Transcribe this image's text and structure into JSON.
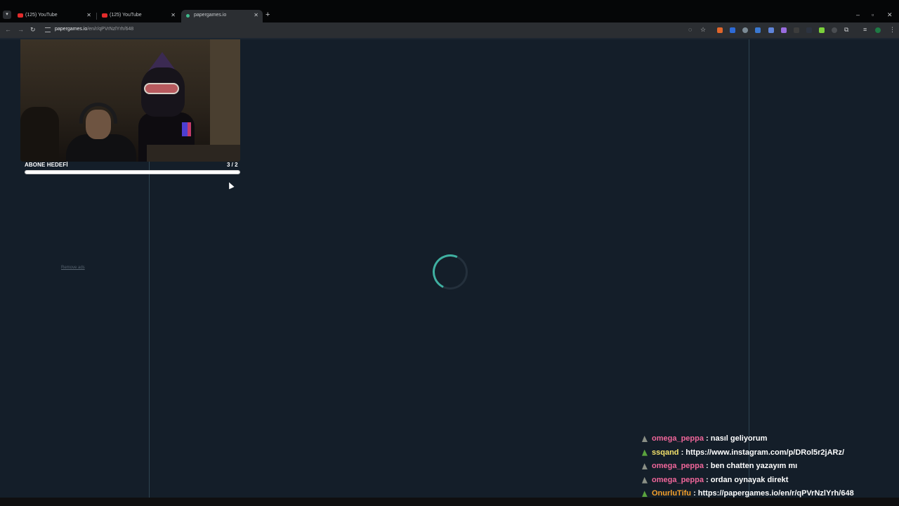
{
  "browser": {
    "tabs": [
      {
        "title": "(125) YouTube",
        "favicon": "youtube-icon",
        "active": false
      },
      {
        "title": "(125) YouTube",
        "favicon": "youtube-icon",
        "active": false
      },
      {
        "title": "papergames.io",
        "favicon": "papergames-icon",
        "active": true
      }
    ],
    "url_host": "papergames.io",
    "url_path": "/en/r/qPVrNzlYrh/648"
  },
  "stream_overlay": {
    "goal_label": "ABONE HEDEFİ",
    "goal_count": "3  / 2",
    "goal_progress": 1.0
  },
  "page": {
    "remove_ads": "Remove ads",
    "loading": true
  },
  "chat": [
    {
      "user": "omega_peppa",
      "user_color": "#f0669a",
      "badge": "grey",
      "message": " : nasıl geliyorum"
    },
    {
      "user": "ssqand",
      "user_color": "#f3e16b",
      "badge": "green",
      "message": " : https://www.instagram.com/p/DRol5r2jARz/"
    },
    {
      "user": "omega_peppa",
      "user_color": "#f0669a",
      "badge": "grey",
      "message": " : ben chatten yazayım mı"
    },
    {
      "user": "omega_peppa",
      "user_color": "#f0669a",
      "badge": "grey",
      "message": " : ordan oynayak direkt"
    },
    {
      "user": "OnurluTifu",
      "user_color": "#f5a12c",
      "badge": "green",
      "message": " : https://papergames.io/en/r/qPVrNzlYrh/648"
    }
  ],
  "colors": {
    "background": "#141e29",
    "spinner_accent": "#3fb0a1"
  }
}
